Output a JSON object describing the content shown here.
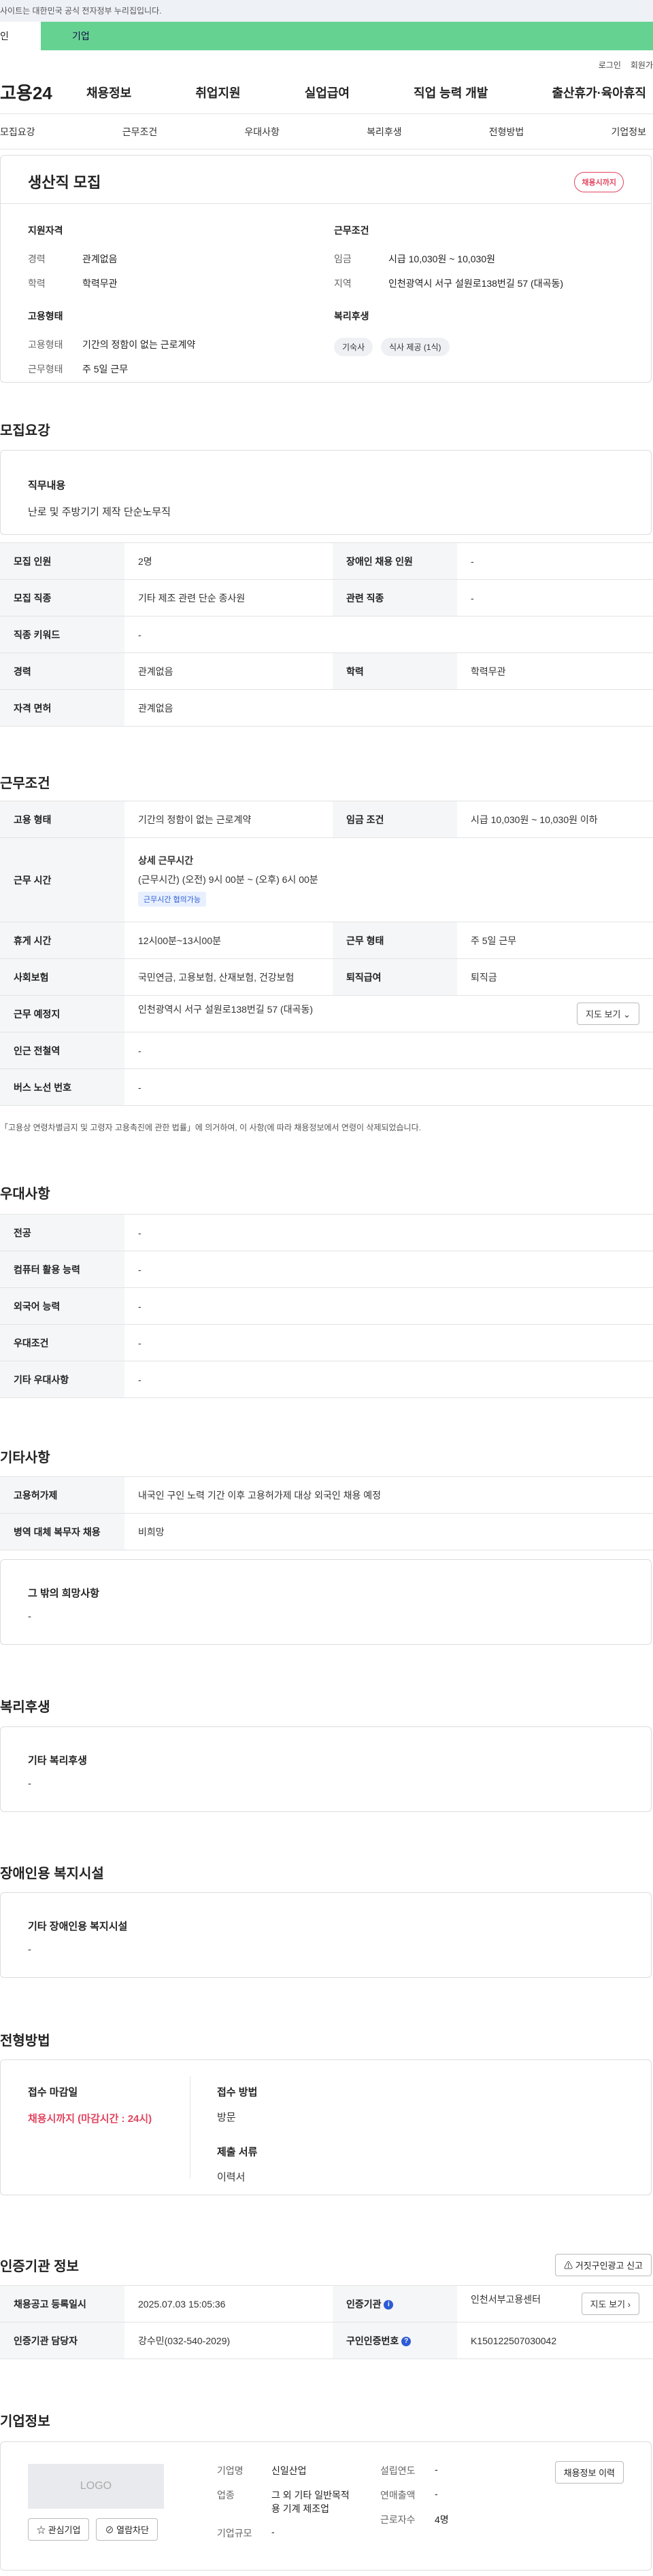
{
  "topbar": {
    "notice": "사이트는 대한민국 공식 전자정부 누리집입니다."
  },
  "service_tabs": {
    "left": "인",
    "right": "기업"
  },
  "util": {
    "login": "로그인",
    "join": "회원가"
  },
  "gnb": {
    "logo": "고용24",
    "menu": [
      "채용정보",
      "취업지원",
      "실업급여",
      "직업 능력 개발",
      "출산휴가·육아휴직"
    ]
  },
  "lnb": [
    "모집요강",
    "근무조건",
    "우대사항",
    "복리후생",
    "전형방법",
    "기업정보"
  ],
  "summary": {
    "title": "생산직 모집",
    "badge": "채용시까지",
    "qual_heading": "지원자격",
    "career_label": "경력",
    "career_value": "관계없음",
    "edu_label": "학력",
    "edu_value": "학력무관",
    "emp_heading": "고용형태",
    "emp_type_label": "고용형태",
    "emp_type_value": "기간의 정함이 없는 근로계약",
    "work_type_label": "근무형태",
    "work_type_value": "주 5일 근무",
    "cond_heading": "근무조건",
    "wage_label": "임금",
    "wage_value": "시급 10,030원 ~ 10,030원",
    "region_label": "지역",
    "region_value": "인천광역시 서구 설원로138번길 57 (대곡동)",
    "welfare_heading": "복리후생",
    "chips": [
      "기숙사",
      "식사 제공 (1식)"
    ]
  },
  "recruit": {
    "title": "모집요강",
    "duty_label": "직무내용",
    "duty_value": "난로 및 주방기기 제작 단순노무직",
    "rows": {
      "count_label": "모집 인원",
      "count_value": "2명",
      "disabled_label": "장애인 채용 인원",
      "disabled_value": "-",
      "job_label": "모집 직종",
      "job_value": "기타 제조 관련 단순 종사원",
      "related_label": "관련 직종",
      "related_value": "-",
      "keyword_label": "직종 키워드",
      "keyword_value": "-",
      "career_label": "경력",
      "career_value": "관계없음",
      "edu_label": "학력",
      "edu_value": "학력무관",
      "license_label": "자격 면허",
      "license_value": "관계없음"
    }
  },
  "work": {
    "title": "근무조건",
    "emp_label": "고용 형태",
    "emp_value": "기간의 정함이 없는 근로계약",
    "wage_label": "임금 조건",
    "wage_value": "시급 10,030원 ~ 10,030원 이하",
    "hours_label": "근무 시간",
    "hours_heading": "상세 근무시간",
    "hours_value": "(근무시간) (오전) 9시 00분 ~ (오후) 6시 00분",
    "hours_badge": "근무시간 협의가능",
    "rest_label": "휴게 시간",
    "rest_value": "12시00분~13시00분",
    "worktype_label": "근무 형태",
    "worktype_value": "주 5일 근무",
    "insurance_label": "사회보험",
    "insurance_value": "국민연금, 고용보험, 산재보험, 건강보험",
    "retire_label": "퇴직급여",
    "retire_value": "퇴직금",
    "place_label": "근무 예정지",
    "place_value": "인천광역시 서구 설원로138번길 57 (대곡동)",
    "map_button": "지도 보기",
    "subway_label": "인근 전철역",
    "subway_value": "-",
    "bus_label": "버스 노선 번호",
    "bus_value": "-",
    "note": "「고용상 연령차별금지 및 고령자 고용촉진에 관한 법률」에 의거하여, 이 사항(에 따라 채용정보에서 연령이 삭제되었습니다."
  },
  "pref": {
    "title": "우대사항",
    "major_label": "전공",
    "major_value": "-",
    "computer_label": "컴퓨터 활용 능력",
    "computer_value": "-",
    "lang_label": "외국어 능력",
    "lang_value": "-",
    "cond_label": "우대조건",
    "cond_value": "-",
    "etc_label": "기타 우대사항",
    "etc_value": "-"
  },
  "etc": {
    "title": "기타사항",
    "permit_label": "고용허가제",
    "permit_value": "내국인 구인 노력 기간 이후 고용허가제 대상 외국인 채용 예정",
    "military_label": "병역 대체 복무자 채용",
    "military_value": "비희망",
    "wish_label": "그 밖의 희망사항",
    "wish_value": "-"
  },
  "welfare": {
    "title": "복리후생",
    "label": "기타 복리후생",
    "value": "-"
  },
  "facility": {
    "title": "장애인용 복지시설",
    "label": "기타 장애인용 복지시설",
    "value": "-"
  },
  "select": {
    "title": "전형방법",
    "deadline_label": "접수 마감일",
    "deadline_value": "채용시까지 (마감시간 : 24시)",
    "method_label": "접수 방법",
    "method_value": "방문",
    "docs_label": "제출 서류",
    "docs_value": "이력서"
  },
  "agency": {
    "title": "인증기관 정보",
    "report_button": "거짓구인광고 신고",
    "reg_label": "채용공고 등록일시",
    "reg_value": "2025.07.03 15:05:36",
    "org_label": "인증기관",
    "org_value": "인천서부고용센터",
    "map_button": "지도 보기",
    "manager_label": "인증기관 담당자",
    "manager_value": "강수민(032-540-2029)",
    "num_label": "구인인증번호",
    "num_value": "K150122507030042"
  },
  "company": {
    "title": "기업정보",
    "logo_text": "LOGO",
    "fav_button": "관심기업",
    "block_button": "열람차단",
    "name_label": "기업명",
    "name_value": "신일산업",
    "industry_label": "업종",
    "industry_value": "그 외 기타 일반목적용 기계 제조업",
    "scale_label": "기업규모",
    "scale_value": "-",
    "founded_label": "설립연도",
    "founded_value": "-",
    "sales_label": "연매출액",
    "sales_value": "-",
    "employees_label": "근로자수",
    "employees_value": "4명",
    "history_button": "채용정보 이력"
  }
}
